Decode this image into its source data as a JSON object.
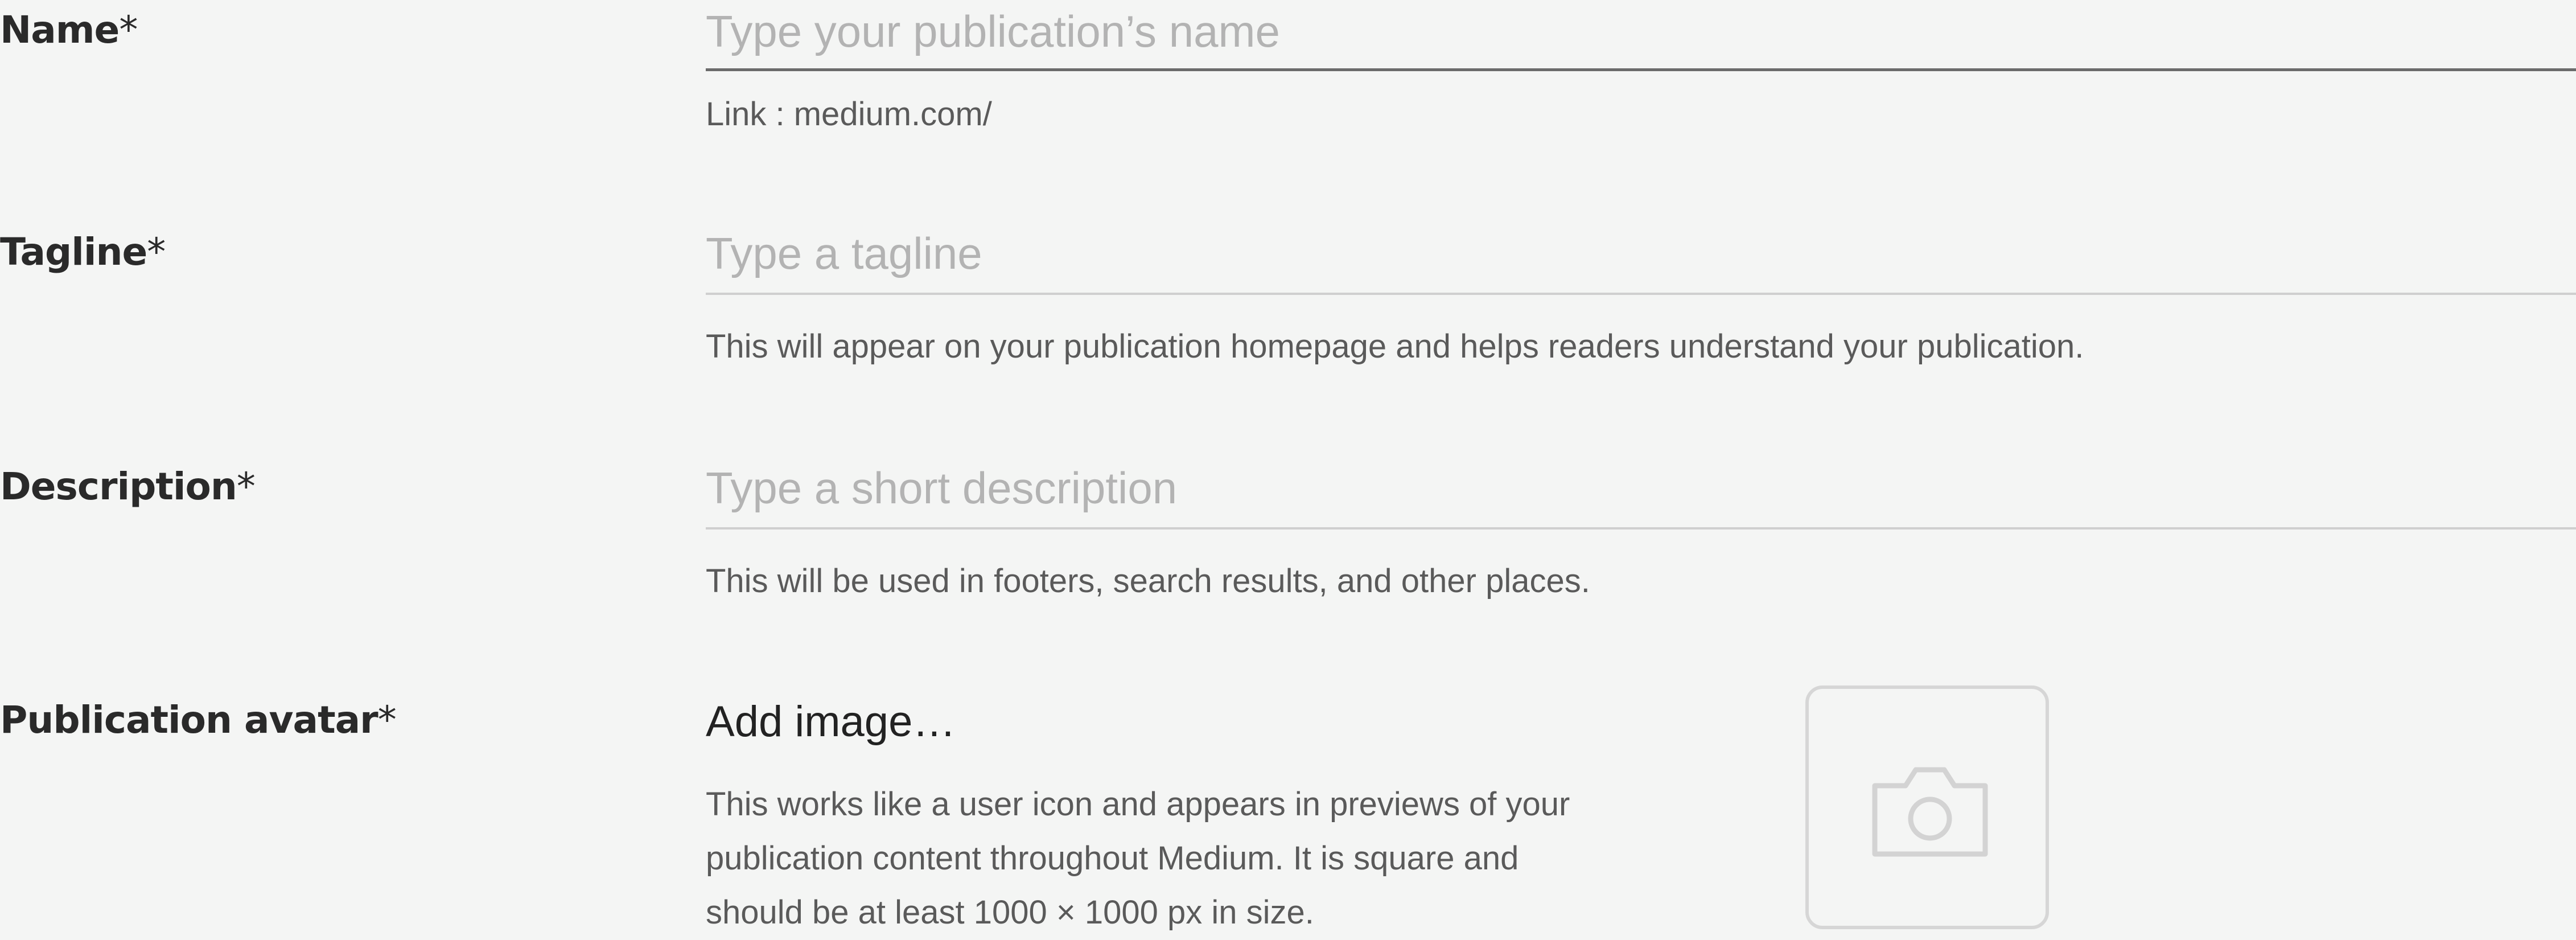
{
  "fields": {
    "name": {
      "label": "Name",
      "required_mark": "*",
      "placeholder": "Type your publication’s name",
      "hint": "Link : medium.com/"
    },
    "tagline": {
      "label": "Tagline",
      "required_mark": "*",
      "placeholder": "Type a tagline",
      "hint": "This will appear on your publication homepage and helps readers understand your publication."
    },
    "description": {
      "label": "Description",
      "required_mark": "*",
      "placeholder": "Type a short description",
      "hint": "This will be used in footers, search results, and other places."
    }
  },
  "avatar": {
    "label": "Publication avatar",
    "required_mark": "*",
    "add_image": "Add image…",
    "help_lines": [
      "This works like a user icon and appears in previews of your",
      "publication content throughout Medium. It is square and",
      "should be at least 1000 × 1000 px in size."
    ],
    "icon": "camera-icon"
  },
  "colors": {
    "background": "#f4f5f4",
    "placeholder": "#b3b3b3",
    "hint": "#5a5a5a",
    "border": "#d6d6d6"
  }
}
